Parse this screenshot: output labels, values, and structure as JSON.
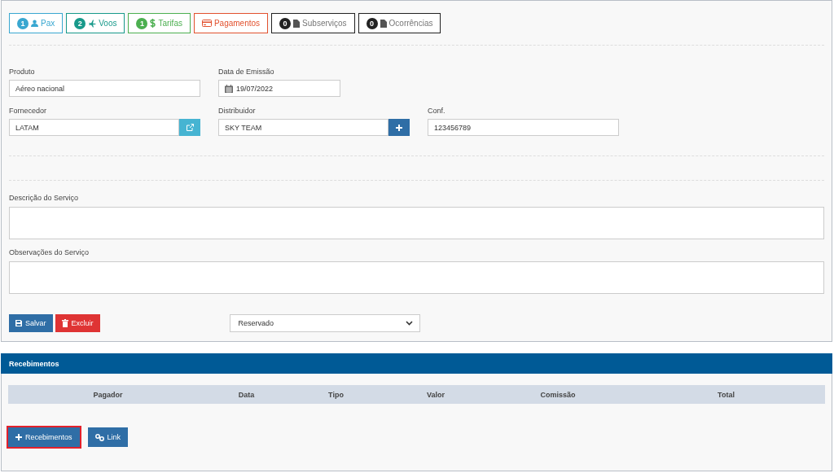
{
  "tabs": [
    {
      "label": "Pax",
      "badge": "1",
      "kind": "person",
      "color": "#39a7d0"
    },
    {
      "label": "Voos",
      "badge": "2",
      "kind": "plane",
      "color": "#17998a"
    },
    {
      "label": "Tarifas",
      "badge": "1",
      "kind": "dollar",
      "color": "#4caf50"
    },
    {
      "label": "Pagamentos",
      "kind": "card",
      "color": "#e2512e"
    },
    {
      "label": "Subserviços",
      "badge": "0",
      "kind": "file",
      "color": "#222222"
    },
    {
      "label": "Ocorrências",
      "badge": "0",
      "kind": "file",
      "color": "#222222"
    }
  ],
  "fields_row_1": [
    {
      "label": "Produto",
      "value": "Aéreo nacional",
      "kind": "text"
    },
    {
      "label": "Data de Emissão",
      "value": "19/07/2022",
      "kind": "date"
    }
  ],
  "fields_row_2": [
    {
      "label": "Fornecedor",
      "value": "LATAM",
      "kind": "link"
    },
    {
      "label": "Distribuidor",
      "value": "SKY TEAM",
      "kind": "add"
    },
    {
      "label": "Conf.",
      "value": "123456789",
      "kind": "text"
    }
  ],
  "description": {
    "label": "Descrição do Serviço"
  },
  "observations": {
    "label": "Observações do Serviço"
  },
  "actions": [
    {
      "label": "Salvar",
      "kind": "save"
    },
    {
      "label": "Excluir",
      "kind": "delete"
    }
  ],
  "status": {
    "value": "Reservado"
  },
  "receipts": {
    "title": "Recebimentos",
    "columns": [
      "Pagador",
      "Data",
      "Tipo",
      "Valor",
      "Comissão",
      "Total"
    ],
    "buttons": [
      {
        "label": "Recebimentos",
        "kind": "add",
        "highlighted": true
      },
      {
        "label": "Link",
        "kind": "link",
        "highlighted": false
      }
    ]
  }
}
